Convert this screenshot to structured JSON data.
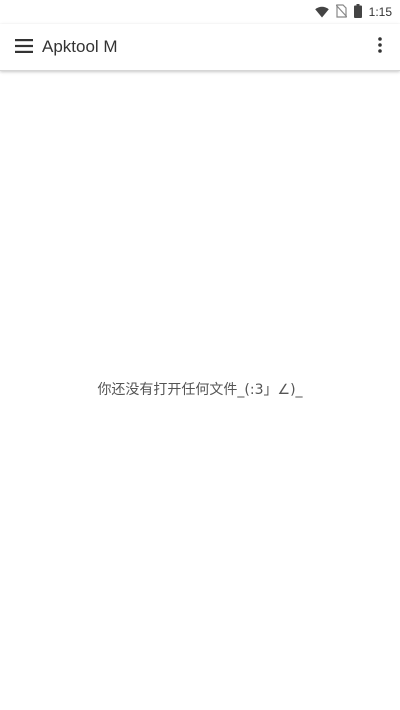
{
  "status_bar": {
    "time": "1:15",
    "icons": [
      "wifi-icon",
      "no-sim-icon",
      "battery-icon"
    ]
  },
  "app_bar": {
    "title": "Apktool M",
    "menu_icon": "hamburger-menu-icon",
    "more_icon": "more-vert-icon"
  },
  "main": {
    "empty_message": "你还没有打开任何文件_(:3」∠)_"
  },
  "colors": {
    "text_primary": "#333333",
    "text_secondary": "#555555",
    "background": "#ffffff"
  }
}
